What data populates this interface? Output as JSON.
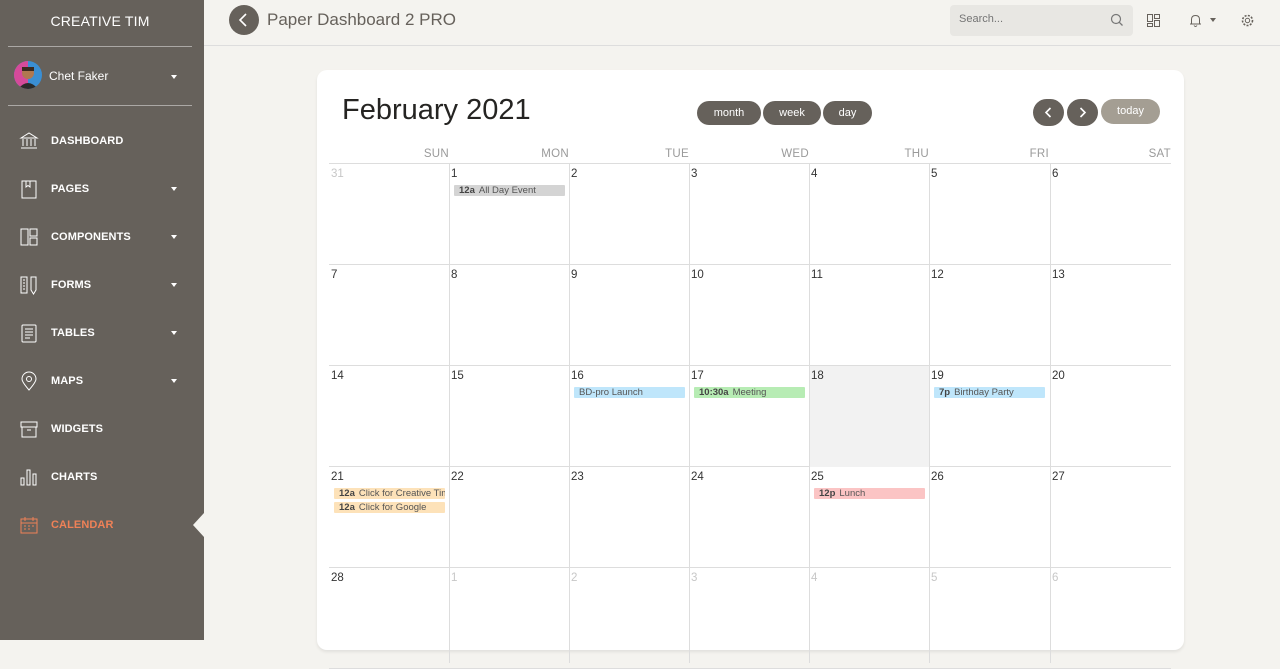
{
  "sidebar": {
    "brand": "CREATIVE TIM",
    "user_name": "Chet Faker",
    "items": [
      {
        "label": "DASHBOARD",
        "icon": "bank-icon",
        "has_caret": false
      },
      {
        "label": "PAGES",
        "icon": "book-icon",
        "has_caret": true
      },
      {
        "label": "COMPONENTS",
        "icon": "layout-icon",
        "has_caret": true
      },
      {
        "label": "FORMS",
        "icon": "ruler-pencil-icon",
        "has_caret": true
      },
      {
        "label": "TABLES",
        "icon": "paper-icon",
        "has_caret": true
      },
      {
        "label": "MAPS",
        "icon": "pin-icon",
        "has_caret": true
      },
      {
        "label": "WIDGETS",
        "icon": "box-icon",
        "has_caret": false
      },
      {
        "label": "CHARTS",
        "icon": "chart-bar-icon",
        "has_caret": false
      },
      {
        "label": "CALENDAR",
        "icon": "calendar-icon",
        "has_caret": false,
        "active": true
      }
    ],
    "active_color": "#ef8157"
  },
  "topbar": {
    "title": "Paper Dashboard 2 PRO",
    "search_placeholder": "Search..."
  },
  "calendar": {
    "title": "February 2021",
    "views": [
      "month",
      "week",
      "day"
    ],
    "today_label": "today",
    "weekdays": [
      "SUN",
      "MON",
      "TUE",
      "WED",
      "THU",
      "FRI",
      "SAT"
    ],
    "weeks": [
      [
        {
          "n": "31",
          "other": true
        },
        {
          "n": "1"
        },
        {
          "n": "2"
        },
        {
          "n": "3"
        },
        {
          "n": "4"
        },
        {
          "n": "5"
        },
        {
          "n": "6"
        }
      ],
      [
        {
          "n": "7"
        },
        {
          "n": "8"
        },
        {
          "n": "9"
        },
        {
          "n": "10"
        },
        {
          "n": "11"
        },
        {
          "n": "12"
        },
        {
          "n": "13"
        }
      ],
      [
        {
          "n": "14"
        },
        {
          "n": "15"
        },
        {
          "n": "16"
        },
        {
          "n": "17"
        },
        {
          "n": "18",
          "today": true
        },
        {
          "n": "19"
        },
        {
          "n": "20"
        }
      ],
      [
        {
          "n": "21"
        },
        {
          "n": "22"
        },
        {
          "n": "23"
        },
        {
          "n": "24"
        },
        {
          "n": "25"
        },
        {
          "n": "26"
        },
        {
          "n": "27"
        }
      ],
      [
        {
          "n": "28"
        },
        {
          "n": "1",
          "other": true
        },
        {
          "n": "2",
          "other": true
        },
        {
          "n": "3",
          "other": true
        },
        {
          "n": "4",
          "other": true
        },
        {
          "n": "5",
          "other": true
        },
        {
          "n": "6",
          "other": true
        }
      ]
    ],
    "events": [
      {
        "week": 0,
        "day": 1,
        "time": "12a",
        "title": "All Day Event",
        "color": "#d4d4d4"
      },
      {
        "week": 2,
        "day": 2,
        "time": "",
        "title": "BD-pro Launch",
        "color": "#bfe6fb"
      },
      {
        "week": 2,
        "day": 3,
        "time": "10:30a",
        "title": "Meeting",
        "color": "#b7ecb4"
      },
      {
        "week": 2,
        "day": 5,
        "time": "7p",
        "title": "Birthday Party",
        "color": "#bfe6fb"
      },
      {
        "week": 3,
        "day": 0,
        "time": "12a",
        "title": "Click for Creative Tim",
        "color": "#fde2b9"
      },
      {
        "week": 3,
        "day": 0,
        "time": "12a",
        "title": "Click for Google",
        "color": "#fde2b9"
      },
      {
        "week": 3,
        "day": 4,
        "time": "12p",
        "title": "Lunch",
        "color": "#fbc4c4"
      }
    ]
  }
}
